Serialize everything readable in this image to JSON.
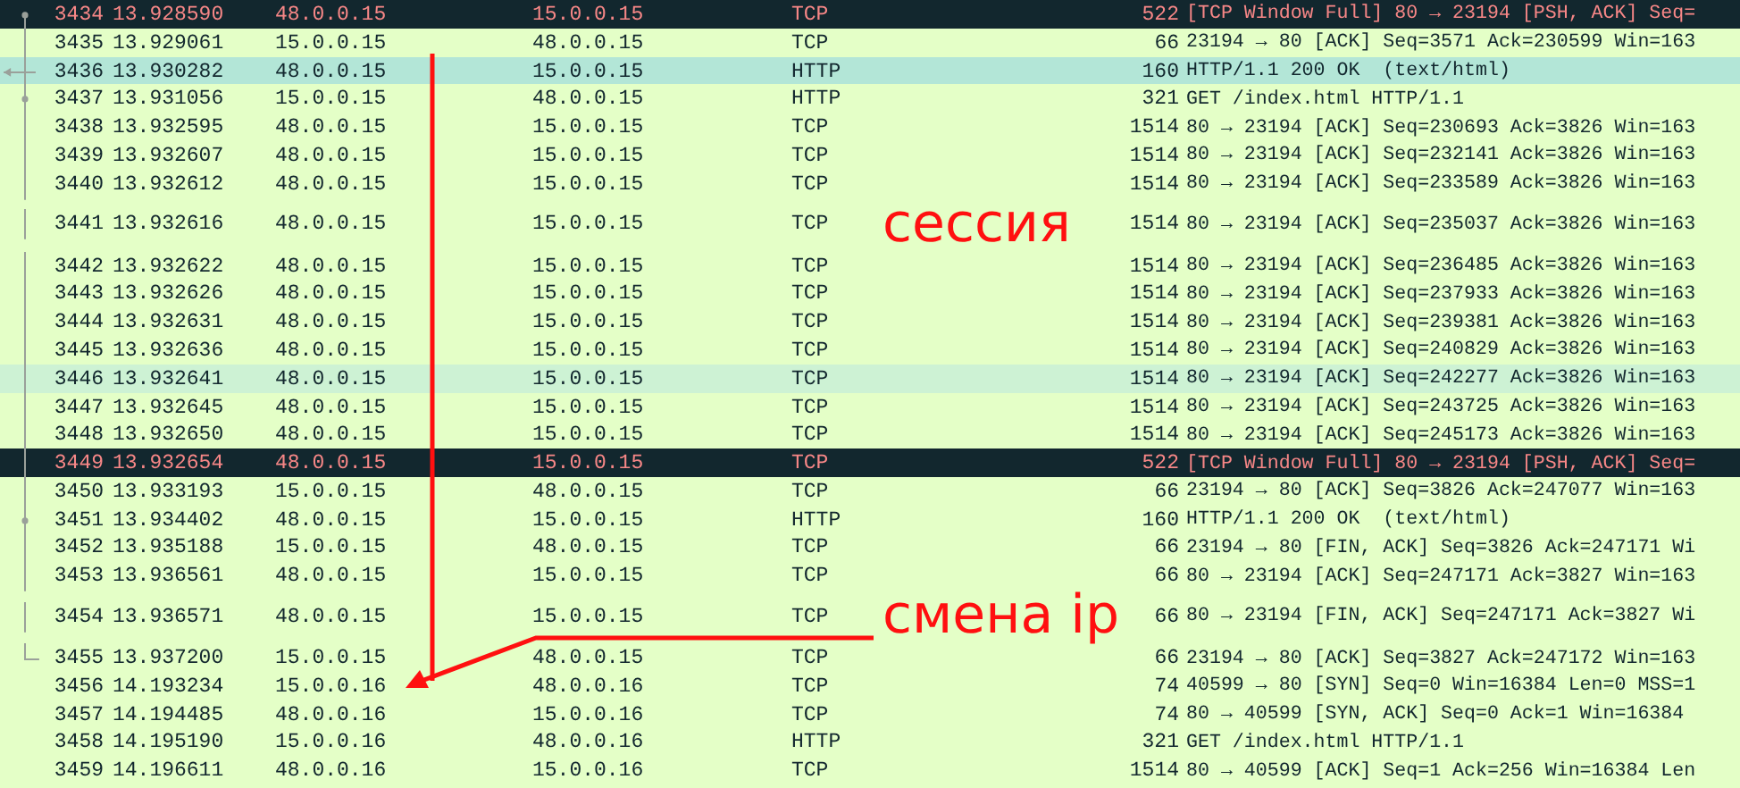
{
  "packets": [
    {
      "no": "3434",
      "time": "13.928590",
      "source": "48.0.0.15",
      "destination": "15.0.0.15",
      "protocol": "TCP",
      "length": "522",
      "info": "[TCP Window Full] 80 → 23194 [PSH, ACK] Seq=",
      "kind": "window-full",
      "selected": false,
      "link": {
        "kind": "start"
      }
    },
    {
      "no": "3435",
      "time": "13.929061",
      "source": "15.0.0.15",
      "destination": "48.0.0.15",
      "protocol": "TCP",
      "length": "66",
      "info": "23194 → 80 [ACK] Seq=3571 Ack=230599 Win=163",
      "kind": "normal",
      "selected": false,
      "link": {
        "kind": "line"
      }
    },
    {
      "no": "3436",
      "time": "13.930282",
      "source": "48.0.0.15",
      "destination": "15.0.0.15",
      "protocol": "HTTP",
      "length": "160",
      "info": "HTTP/1.1 200 OK  (text/html)",
      "kind": "normal",
      "selected": true,
      "link": {
        "kind": "arrow"
      }
    },
    {
      "no": "3437",
      "time": "13.931056",
      "source": "15.0.0.15",
      "destination": "48.0.0.15",
      "protocol": "HTTP",
      "length": "321",
      "info": "GET /index.html HTTP/1.1",
      "kind": "normal",
      "selected": false,
      "link": {
        "kind": "dot"
      }
    },
    {
      "no": "3438",
      "time": "13.932595",
      "source": "48.0.0.15",
      "destination": "15.0.0.15",
      "protocol": "TCP",
      "length": "1514",
      "info": "80 → 23194 [ACK] Seq=230693 Ack=3826 Win=163",
      "kind": "normal",
      "selected": false,
      "link": {
        "kind": "line"
      }
    },
    {
      "no": "3439",
      "time": "13.932607",
      "source": "48.0.0.15",
      "destination": "15.0.0.15",
      "protocol": "TCP",
      "length": "1514",
      "info": "80 → 23194 [ACK] Seq=232141 Ack=3826 Win=163",
      "kind": "normal",
      "selected": false,
      "link": {
        "kind": "line"
      }
    },
    {
      "no": "3440",
      "time": "13.932612",
      "source": "48.0.0.15",
      "destination": "15.0.0.15",
      "protocol": "TCP",
      "length": "1514",
      "info": "80 → 23194 [ACK] Seq=233589 Ack=3826 Win=163",
      "kind": "normal",
      "selected": false,
      "link": {
        "kind": "line"
      }
    },
    {
      "no": "3441",
      "time": "13.932616",
      "source": "48.0.0.15",
      "destination": "15.0.0.15",
      "protocol": "TCP",
      "length": "1514",
      "info": "80 → 23194 [ACK] Seq=235037 Ack=3826 Win=163",
      "kind": "normal",
      "selected": false,
      "link": {
        "kind": "line"
      },
      "note": "сессия"
    },
    {
      "no": "3442",
      "time": "13.932622",
      "source": "48.0.0.15",
      "destination": "15.0.0.15",
      "protocol": "TCP",
      "length": "1514",
      "info": "80 → 23194 [ACK] Seq=236485 Ack=3826 Win=163",
      "kind": "normal",
      "selected": false,
      "link": {
        "kind": "line"
      }
    },
    {
      "no": "3443",
      "time": "13.932626",
      "source": "48.0.0.15",
      "destination": "15.0.0.15",
      "protocol": "TCP",
      "length": "1514",
      "info": "80 → 23194 [ACK] Seq=237933 Ack=3826 Win=163",
      "kind": "normal",
      "selected": false,
      "link": {
        "kind": "line"
      }
    },
    {
      "no": "3444",
      "time": "13.932631",
      "source": "48.0.0.15",
      "destination": "15.0.0.15",
      "protocol": "TCP",
      "length": "1514",
      "info": "80 → 23194 [ACK] Seq=239381 Ack=3826 Win=163",
      "kind": "normal",
      "selected": false,
      "link": {
        "kind": "line"
      }
    },
    {
      "no": "3445",
      "time": "13.932636",
      "source": "48.0.0.15",
      "destination": "15.0.0.15",
      "protocol": "TCP",
      "length": "1514",
      "info": "80 → 23194 [ACK] Seq=240829 Ack=3826 Win=163",
      "kind": "normal",
      "selected": false,
      "link": {
        "kind": "line"
      }
    },
    {
      "no": "3446",
      "time": "13.932641",
      "source": "48.0.0.15",
      "destination": "15.0.0.15",
      "protocol": "TCP",
      "length": "1514",
      "info": "80 → 23194 [ACK] Seq=242277 Ack=3826 Win=163",
      "kind": "related",
      "selected": false,
      "link": {
        "kind": "line"
      }
    },
    {
      "no": "3447",
      "time": "13.932645",
      "source": "48.0.0.15",
      "destination": "15.0.0.15",
      "protocol": "TCP",
      "length": "1514",
      "info": "80 → 23194 [ACK] Seq=243725 Ack=3826 Win=163",
      "kind": "normal",
      "selected": false,
      "link": {
        "kind": "line"
      }
    },
    {
      "no": "3448",
      "time": "13.932650",
      "source": "48.0.0.15",
      "destination": "15.0.0.15",
      "protocol": "TCP",
      "length": "1514",
      "info": "80 → 23194 [ACK] Seq=245173 Ack=3826 Win=163",
      "kind": "normal",
      "selected": false,
      "link": {
        "kind": "line"
      }
    },
    {
      "no": "3449",
      "time": "13.932654",
      "source": "48.0.0.15",
      "destination": "15.0.0.15",
      "protocol": "TCP",
      "length": "522",
      "info": "[TCP Window Full] 80 → 23194 [PSH, ACK] Seq=",
      "kind": "window-full",
      "selected": false,
      "link": {
        "kind": "line"
      }
    },
    {
      "no": "3450",
      "time": "13.933193",
      "source": "15.0.0.15",
      "destination": "48.0.0.15",
      "protocol": "TCP",
      "length": "66",
      "info": "23194 → 80 [ACK] Seq=3826 Ack=247077 Win=163",
      "kind": "normal",
      "selected": false,
      "link": {
        "kind": "line"
      }
    },
    {
      "no": "3451",
      "time": "13.934402",
      "source": "48.0.0.15",
      "destination": "15.0.0.15",
      "protocol": "HTTP",
      "length": "160",
      "info": "HTTP/1.1 200 OK  (text/html)",
      "kind": "normal",
      "selected": false,
      "link": {
        "kind": "dot"
      }
    },
    {
      "no": "3452",
      "time": "13.935188",
      "source": "15.0.0.15",
      "destination": "48.0.0.15",
      "protocol": "TCP",
      "length": "66",
      "info": "23194 → 80 [FIN, ACK] Seq=3826 Ack=247171 Wi",
      "kind": "normal",
      "selected": false,
      "link": {
        "kind": "line"
      }
    },
    {
      "no": "3453",
      "time": "13.936561",
      "source": "48.0.0.15",
      "destination": "15.0.0.15",
      "protocol": "TCP",
      "length": "66",
      "info": "80 → 23194 [ACK] Seq=247171 Ack=3827 Win=163",
      "kind": "normal",
      "selected": false,
      "link": {
        "kind": "line"
      }
    },
    {
      "no": "3454",
      "time": "13.936571",
      "source": "48.0.0.15",
      "destination": "15.0.0.15",
      "protocol": "TCP",
      "length": "66",
      "info": "80 → 23194 [FIN, ACK] Seq=247171 Ack=3827 Wi",
      "kind": "normal",
      "selected": false,
      "link": {
        "kind": "line"
      },
      "note": "смена ip"
    },
    {
      "no": "3455",
      "time": "13.937200",
      "source": "15.0.0.15",
      "destination": "48.0.0.15",
      "protocol": "TCP",
      "length": "66",
      "info": "23194 → 80 [ACK] Seq=3827 Ack=247172 Win=163",
      "kind": "normal",
      "selected": false,
      "link": {
        "kind": "end"
      }
    },
    {
      "no": "3456",
      "time": "14.193234",
      "source": "15.0.0.16",
      "destination": "48.0.0.16",
      "protocol": "TCP",
      "length": "74",
      "info": "40599 → 80 [SYN] Seq=0 Win=16384 Len=0 MSS=1",
      "kind": "normal",
      "selected": false
    },
    {
      "no": "3457",
      "time": "14.194485",
      "source": "48.0.0.16",
      "destination": "15.0.0.16",
      "protocol": "TCP",
      "length": "74",
      "info": "80 → 40599 [SYN, ACK] Seq=0 Ack=1 Win=16384",
      "kind": "normal",
      "selected": false
    },
    {
      "no": "3458",
      "time": "14.195190",
      "source": "15.0.0.16",
      "destination": "48.0.0.16",
      "protocol": "HTTP",
      "length": "321",
      "info": "GET /index.html HTTP/1.1",
      "kind": "normal",
      "selected": false
    },
    {
      "no": "3459",
      "time": "14.196611",
      "source": "48.0.0.16",
      "destination": "15.0.0.16",
      "protocol": "TCP",
      "length": "1514",
      "info": "80 → 40599 [ACK] Seq=1 Ack=256 Win=16384 Len",
      "kind": "normal",
      "selected": false
    }
  ]
}
